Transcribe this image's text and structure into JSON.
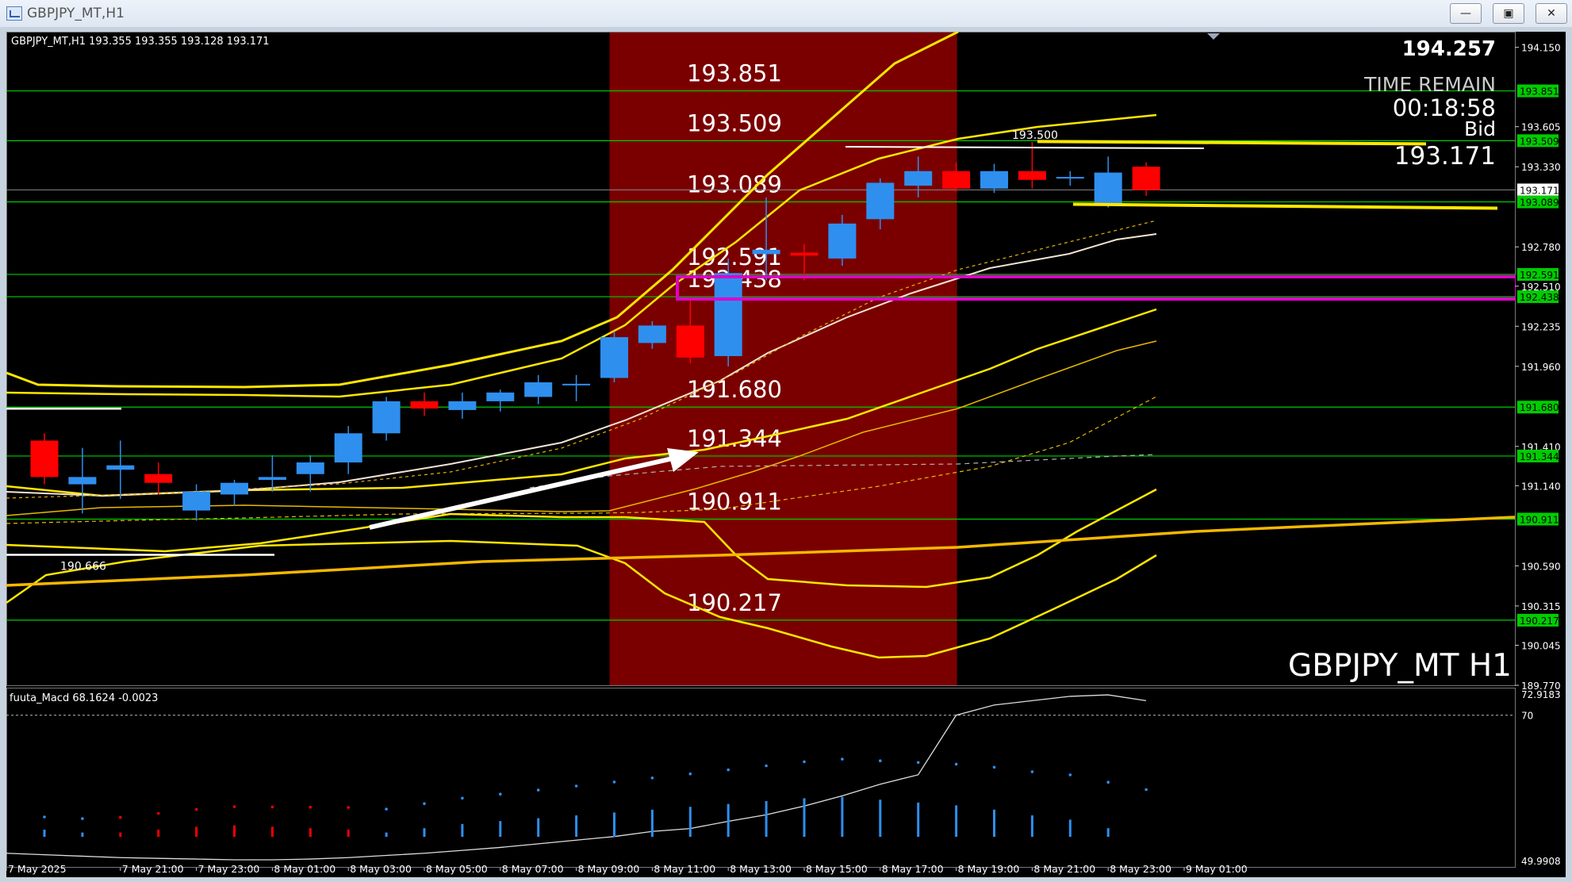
{
  "window": {
    "title": "GBPJPY_MT,H1",
    "buttons": [
      "minimize",
      "maximize",
      "close"
    ]
  },
  "header_info": "GBPJPY_MT,H1  193.355 193.355 193.128 193.171",
  "price_big": "194.257",
  "time_remain": {
    "label": "TIME REMAIN",
    "value": "00:18:58"
  },
  "bid": {
    "label": "Bid",
    "value": "193.171"
  },
  "symbol_label": "GBPJPY_MT H1",
  "macd_header": "fuuta_Macd 68.1624  -0.0023",
  "colors": {
    "bull": "#2f8fef",
    "bear": "#ff0000",
    "highlight": "#7a0000",
    "level": "#00cc00",
    "band": "#ffe600",
    "rect": "#e000c8"
  },
  "chart_data": {
    "type": "candlestick",
    "instrument": "GBPJPY_MT",
    "timeframe": "H1",
    "ylim": [
      189.77,
      194.257
    ],
    "y_ticks": [
      "194.150",
      "193.851",
      "193.605",
      "193.509",
      "193.330",
      "193.171",
      "193.089",
      "192.780",
      "192.591",
      "192.510",
      "192.438",
      "192.235",
      "191.960",
      "191.680",
      "191.410",
      "191.344",
      "191.140",
      "190.911",
      "190.590",
      "190.315",
      "190.217",
      "190.045",
      "189.770"
    ],
    "x_labels": [
      "7 May 2025",
      "7 May 21:00",
      "7 May 23:00",
      "8 May 01:00",
      "8 May 03:00",
      "8 May 05:00",
      "8 May 07:00",
      "8 May 09:00",
      "8 May 11:00",
      "8 May 13:00",
      "8 May 15:00",
      "8 May 17:00",
      "8 May 19:00",
      "8 May 21:00",
      "8 May 23:00",
      "9 May 01:00"
    ],
    "levels": [
      {
        "price": 193.851,
        "label": "193.851"
      },
      {
        "price": 193.509,
        "label": "193.509"
      },
      {
        "price": 193.089,
        "label": "193.089"
      },
      {
        "price": 192.591,
        "label": "192.591"
      },
      {
        "price": 192.438,
        "label": "192.438"
      },
      {
        "price": 191.68,
        "label": "191.680"
      },
      {
        "price": 191.344,
        "label": "191.344"
      },
      {
        "price": 190.911,
        "label": "190.911"
      },
      {
        "price": 190.217,
        "label": "190.217"
      }
    ],
    "annotations": [
      {
        "price": 190.666,
        "label": "190.666"
      },
      {
        "price": 193.5,
        "label": "193.500"
      }
    ],
    "current_price": {
      "value": 193.171,
      "label": "193.171"
    },
    "candles": [
      {
        "o": 191.45,
        "h": 191.5,
        "l": 191.15,
        "c": 191.2
      },
      {
        "o": 191.15,
        "h": 191.4,
        "l": 190.95,
        "c": 191.2
      },
      {
        "o": 191.25,
        "h": 191.45,
        "l": 191.05,
        "c": 191.28
      },
      {
        "o": 191.22,
        "h": 191.3,
        "l": 191.08,
        "c": 191.16
      },
      {
        "o": 190.97,
        "h": 191.15,
        "l": 190.9,
        "c": 191.1
      },
      {
        "o": 191.08,
        "h": 191.18,
        "l": 191.0,
        "c": 191.16
      },
      {
        "o": 191.18,
        "h": 191.35,
        "l": 191.1,
        "c": 191.2
      },
      {
        "o": 191.22,
        "h": 191.35,
        "l": 191.1,
        "c": 191.3
      },
      {
        "o": 191.3,
        "h": 191.55,
        "l": 191.22,
        "c": 191.5
      },
      {
        "o": 191.5,
        "h": 191.75,
        "l": 191.45,
        "c": 191.72
      },
      {
        "o": 191.72,
        "h": 191.78,
        "l": 191.62,
        "c": 191.67
      },
      {
        "o": 191.66,
        "h": 191.78,
        "l": 191.6,
        "c": 191.72
      },
      {
        "o": 191.72,
        "h": 191.8,
        "l": 191.65,
        "c": 191.78
      },
      {
        "o": 191.75,
        "h": 191.9,
        "l": 191.7,
        "c": 191.85
      },
      {
        "o": 191.84,
        "h": 191.9,
        "l": 191.72,
        "c": 191.84
      },
      {
        "o": 191.88,
        "h": 192.2,
        "l": 191.85,
        "c": 192.16
      },
      {
        "o": 192.12,
        "h": 192.27,
        "l": 192.08,
        "c": 192.24
      },
      {
        "o": 192.24,
        "h": 192.42,
        "l": 191.98,
        "c": 192.02
      },
      {
        "o": 192.03,
        "h": 192.7,
        "l": 191.96,
        "c": 192.6
      },
      {
        "o": 192.73,
        "h": 193.12,
        "l": 192.55,
        "c": 192.76
      },
      {
        "o": 192.74,
        "h": 192.8,
        "l": 192.55,
        "c": 192.72
      },
      {
        "o": 192.7,
        "h": 193.0,
        "l": 192.65,
        "c": 192.94
      },
      {
        "o": 192.97,
        "h": 193.25,
        "l": 192.9,
        "c": 193.22
      },
      {
        "o": 193.2,
        "h": 193.4,
        "l": 193.12,
        "c": 193.3
      },
      {
        "o": 193.3,
        "h": 193.36,
        "l": 193.16,
        "c": 193.18
      },
      {
        "o": 193.18,
        "h": 193.35,
        "l": 193.15,
        "c": 193.3
      },
      {
        "o": 193.3,
        "h": 193.5,
        "l": 193.18,
        "c": 193.24
      },
      {
        "o": 193.26,
        "h": 193.3,
        "l": 193.2,
        "c": 193.26
      },
      {
        "o": 193.08,
        "h": 193.4,
        "l": 193.05,
        "c": 193.29
      },
      {
        "o": 193.33,
        "h": 193.36,
        "l": 193.13,
        "c": 193.17
      }
    ],
    "macd": {
      "scale": [
        "72.9183",
        "70",
        "49.9908"
      ],
      "ylim": [
        49.9908,
        72.9183
      ],
      "line": [
        51.0,
        50.8,
        50.6,
        50.4,
        50.3,
        50.2,
        50.1,
        50.1,
        50.2,
        50.4,
        50.7,
        51.0,
        51.4,
        51.8,
        52.3,
        52.8,
        53.3,
        54.0,
        54.4,
        55.4,
        56.3,
        57.5,
        58.9,
        60.5,
        61.8,
        70.0,
        71.4,
        72.0,
        72.6,
        72.8,
        72.0
      ],
      "histogram": [
        0.5,
        0.3,
        -0.3,
        -0.5,
        -0.7,
        -0.8,
        -0.7,
        -0.6,
        -0.5,
        0.3,
        0.6,
        0.9,
        1.1,
        1.3,
        1.5,
        1.7,
        1.9,
        2.1,
        2.3,
        2.5,
        2.7,
        2.8,
        2.6,
        2.4,
        2.2,
        1.9,
        1.5,
        1.2,
        0.6,
        0.0
      ]
    }
  }
}
